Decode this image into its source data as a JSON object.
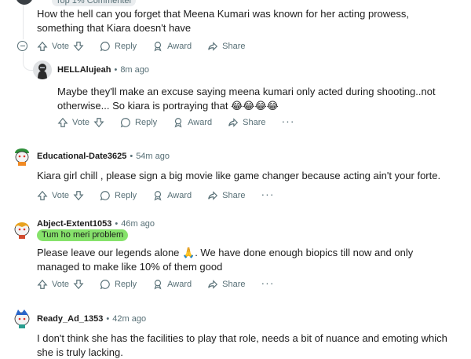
{
  "top_comment": {
    "flair": "Top 1% Commenter",
    "text": "How the hell can you forget that Meena Kumari was known for her acting prowess, something that Kiara doesn't have"
  },
  "actions": {
    "vote": "Vote",
    "reply": "Reply",
    "award": "Award",
    "share": "Share",
    "more": "···"
  },
  "comments": [
    {
      "author": "HELLAlujeah",
      "time": "8m ago",
      "text": "Maybe they'll make an excuse saying meena kumari only acted during shooting..not otherwise... So kiara is portraying that 😂😂😂😂"
    },
    {
      "author": "Educational-Date3625",
      "time": "54m ago",
      "text": "Kiara girl chill , please sign a big movie like game changer because acting ain't your forte."
    },
    {
      "author": "Abject-Extent1053",
      "time": "46m ago",
      "flair": "Tum ho meri problem",
      "text": "Please leave our legends alone 🙏. We have done enough biopics till now and only managed to make like 10% of them good"
    },
    {
      "author": "Ready_Ad_1353",
      "time": "42m ago",
      "text": "I don't think she has the facilities to play that role, needs a bit of nuance and emoting which she is truly lacking."
    }
  ]
}
